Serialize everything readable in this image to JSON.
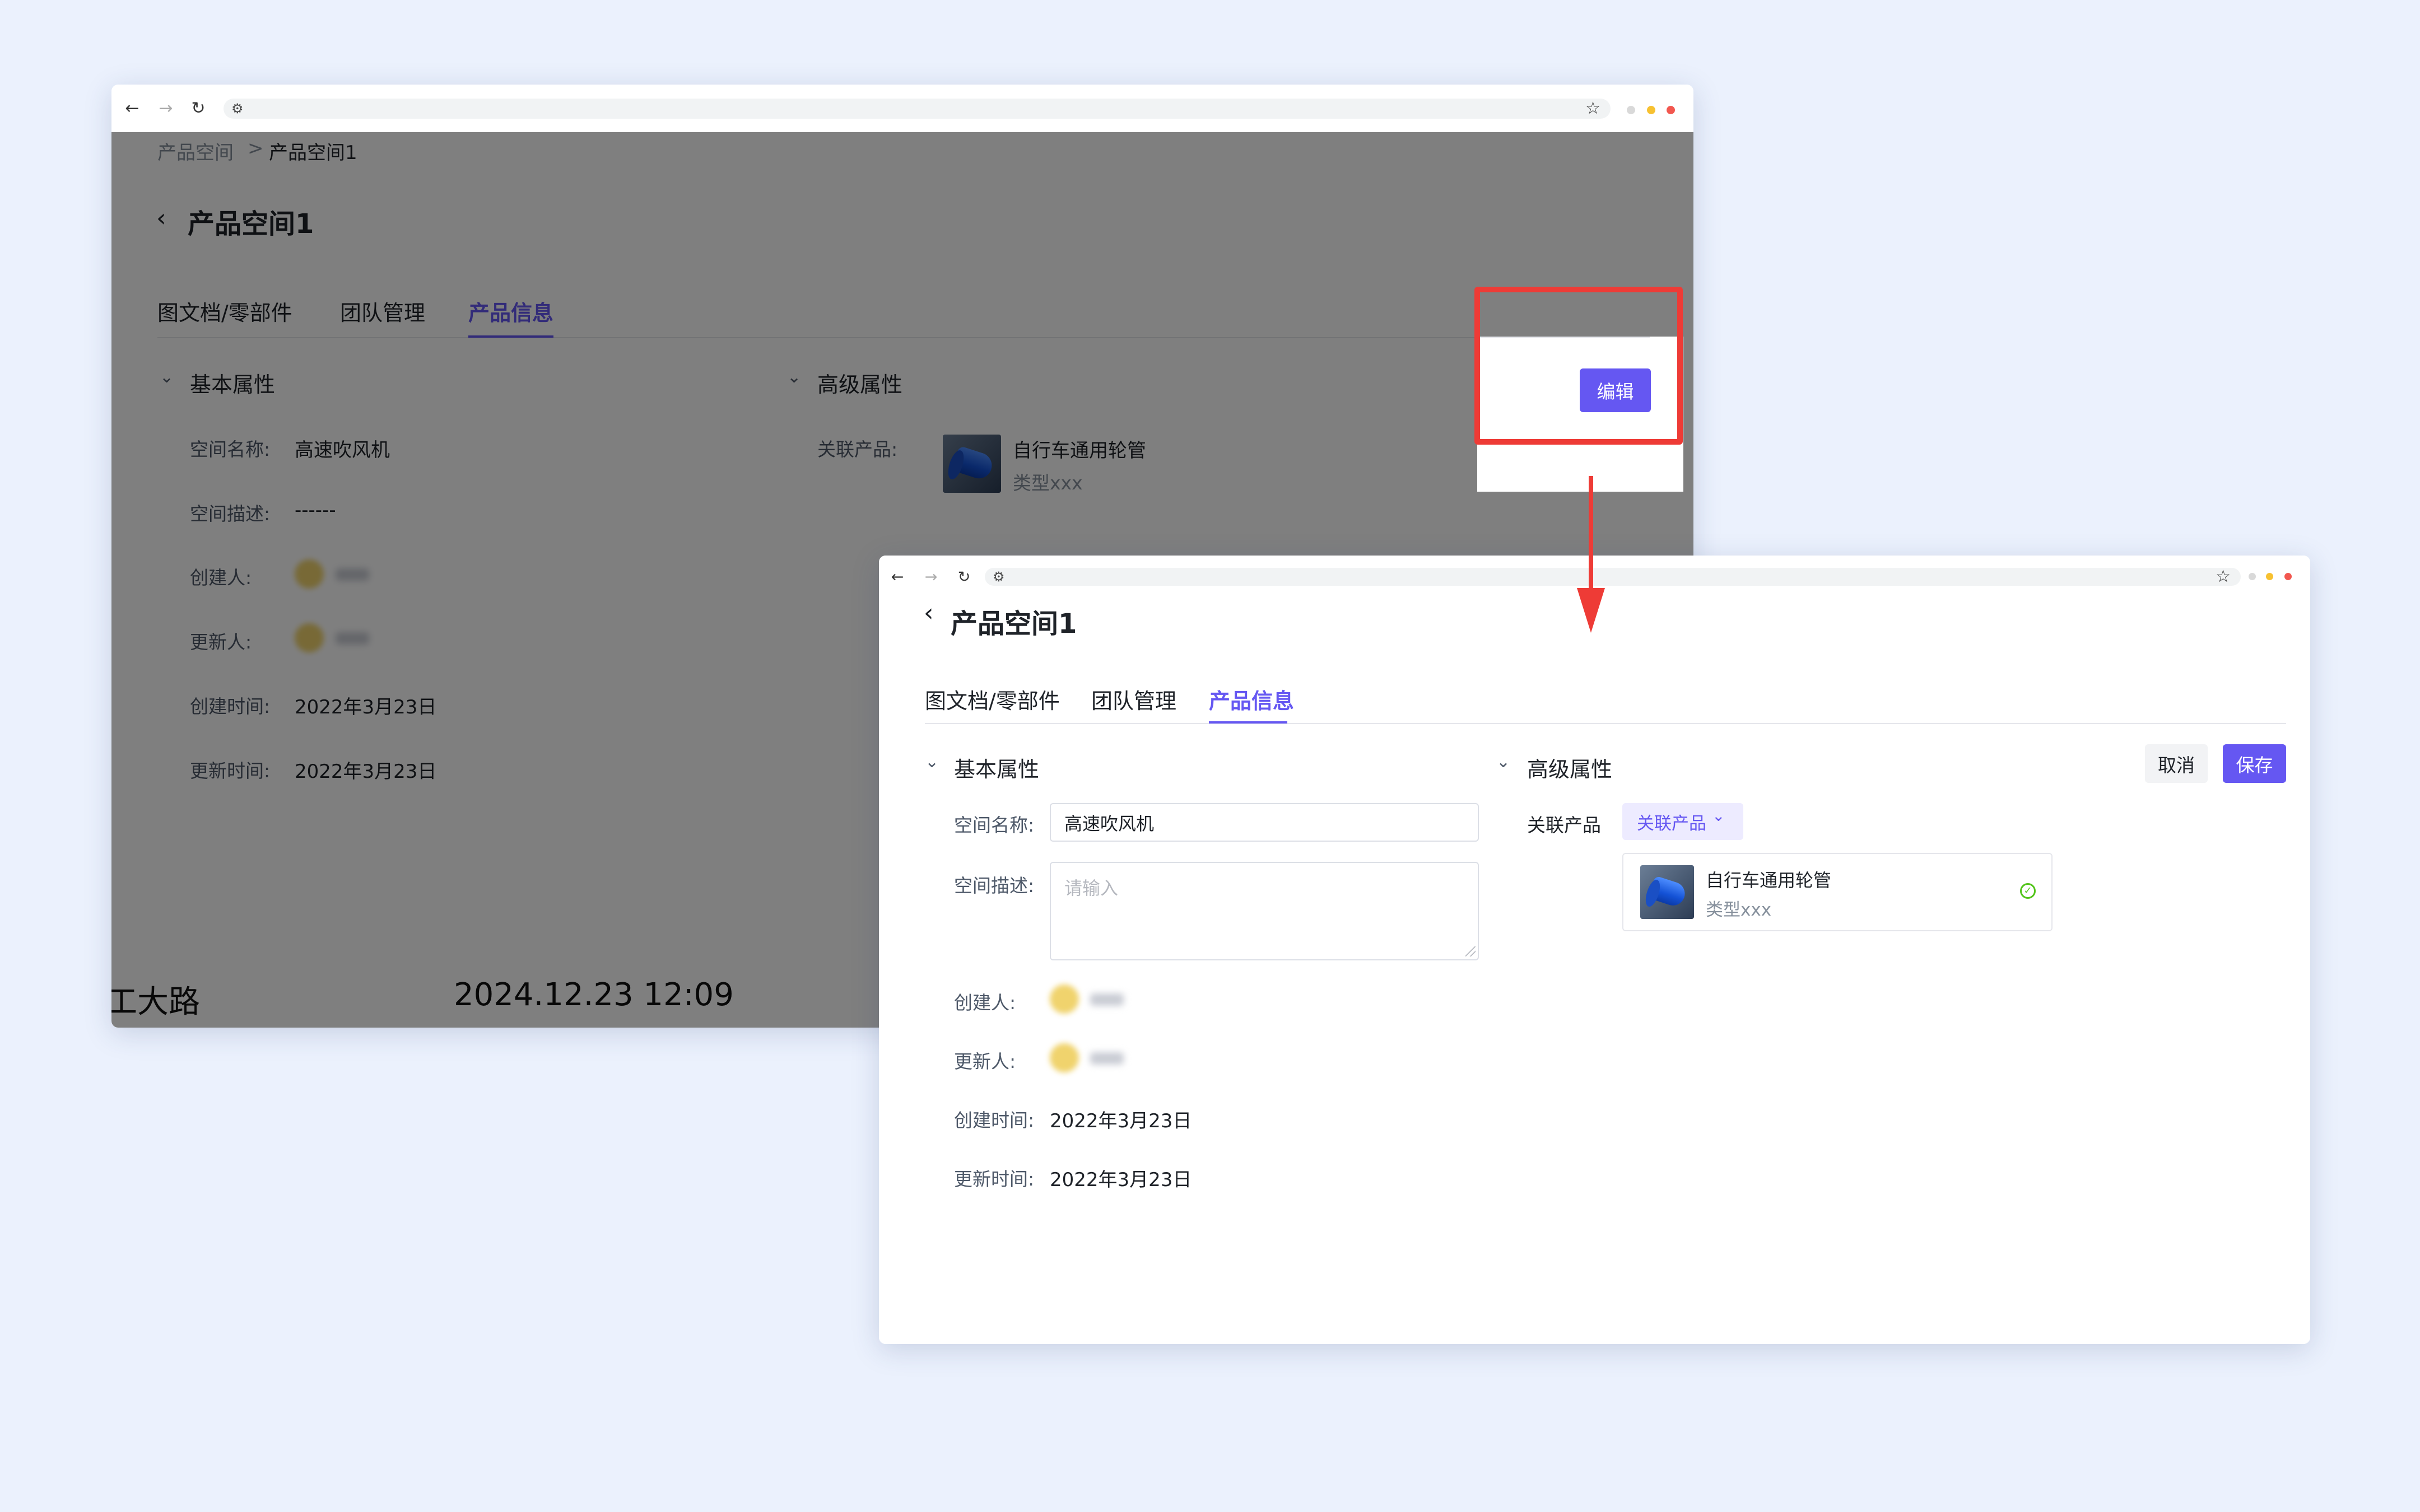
{
  "colors": {
    "accent": "#6557f2",
    "callout": "#ee3b36",
    "background": "#ebf1fd",
    "success": "#52c41a"
  },
  "browser": {
    "back_icon": "arrow-left-icon",
    "forward_icon": "arrow-right-icon",
    "reload_icon": "reload-icon",
    "site_settings_icon": "tune-icon",
    "bookmark_icon": "star-icon"
  },
  "view_window": {
    "breadcrumb": {
      "parent": "产品空间",
      "separator": ">",
      "current": "产品空间1"
    },
    "title": "产品空间1",
    "tabs": [
      {
        "label": "图文档/零部件",
        "active": false
      },
      {
        "label": "团队管理",
        "active": false
      },
      {
        "label": "产品信息",
        "active": true
      }
    ],
    "edit_button": "编辑",
    "basic": {
      "heading": "基本属性",
      "fields": [
        {
          "label": "空间名称:",
          "value": "高速吹风机"
        },
        {
          "label": "空间描述:",
          "value": "------"
        },
        {
          "label": "创建人:",
          "value": ""
        },
        {
          "label": "更新人:",
          "value": ""
        },
        {
          "label": "创建时间:",
          "value": "2022年3月23日"
        },
        {
          "label": "更新时间:",
          "value": "2022年3月23日"
        }
      ]
    },
    "advanced": {
      "heading": "高级属性",
      "linked_label": "关联产品:",
      "product_name": "自行车通用轮管",
      "product_type": "类型xxx"
    },
    "footer": {
      "location": "工大路",
      "timestamp": "2024.12.23 12:09"
    }
  },
  "edit_window": {
    "title": "产品空间1",
    "tabs": [
      {
        "label": "图文档/零部件",
        "active": false
      },
      {
        "label": "团队管理",
        "active": false
      },
      {
        "label": "产品信息",
        "active": true
      }
    ],
    "cancel_button": "取消",
    "save_button": "保存",
    "basic": {
      "heading": "基本属性",
      "name_label": "空间名称:",
      "name_value": "高速吹风机",
      "desc_label": "空间描述:",
      "desc_placeholder": "请输入",
      "creator_label": "创建人:",
      "updater_label": "更新人:",
      "created_label": "创建时间:",
      "created_value": "2022年3月23日",
      "updated_label": "更新时间:",
      "updated_value": "2022年3月23日"
    },
    "advanced": {
      "heading": "高级属性",
      "linked_label": "关联产品",
      "linked_button": "关联产品",
      "product_name": "自行车通用轮管",
      "product_type": "类型xxx"
    }
  }
}
